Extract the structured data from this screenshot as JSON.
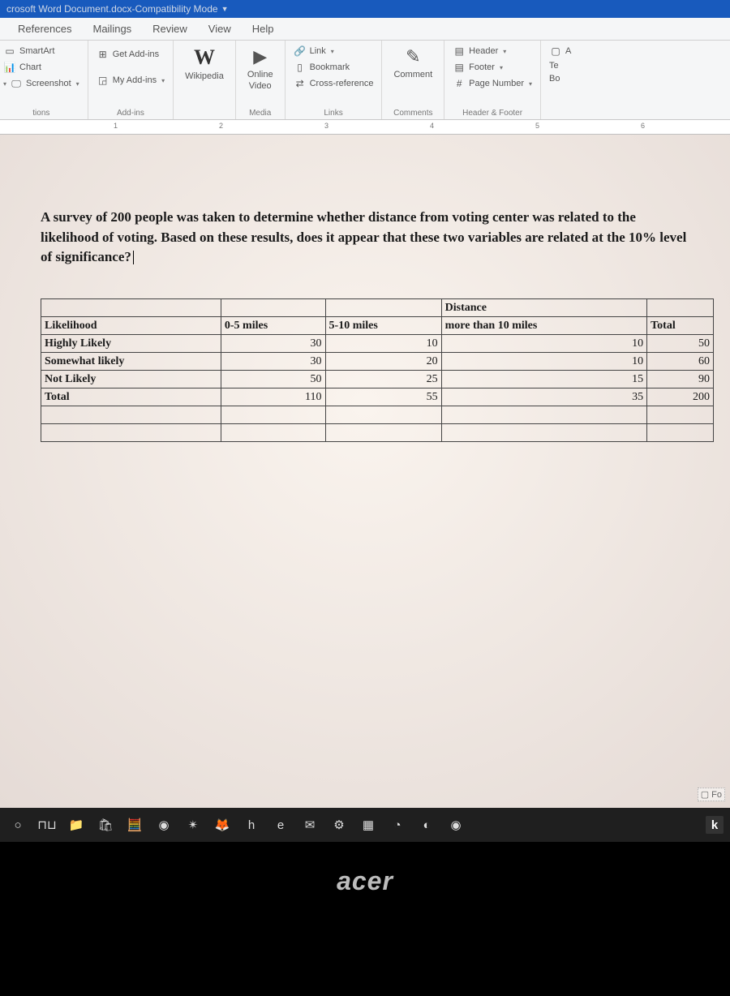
{
  "title": {
    "doc": "crosoft Word Document.docx",
    "sep": " - ",
    "mode": "Compatibility Mode"
  },
  "tabs": [
    "References",
    "Mailings",
    "Review",
    "View",
    "Help"
  ],
  "ribbon": {
    "illustrations": {
      "label": "tions",
      "smartart": "SmartArt",
      "chart": "Chart",
      "screenshot": "Screenshot"
    },
    "addins": {
      "label": "Add-ins",
      "get": "Get Add-ins",
      "my": "My Add-ins"
    },
    "wikipedia": {
      "label": "Wikipedia"
    },
    "media": {
      "label": "Media",
      "online": "Online",
      "video": "Video"
    },
    "links": {
      "label": "Links",
      "link": "Link",
      "bookmark": "Bookmark",
      "cross": "Cross-reference"
    },
    "comments": {
      "label": "Comments",
      "comment": "Comment"
    },
    "headerfooter": {
      "label": "Header & Footer",
      "header": "Header",
      "footer": "Footer",
      "pagenum": "Page Number"
    },
    "text": {
      "label_a": "A",
      "te": "Te",
      "bo": "Bo"
    }
  },
  "ruler_numbers": [
    "1",
    "2",
    "3",
    "4",
    "5",
    "6"
  ],
  "document": {
    "paragraph": "A survey of 200 people was taken to determine whether distance from voting center was related to the likelihood of voting. Based on these results, does it appear that these two variables are related at the 10% level of significance?",
    "table": {
      "distance_header": "Distance",
      "cols": [
        "Likelihood",
        "0-5 miles",
        "5-10 miles",
        "more than 10 miles",
        "Total"
      ],
      "rows": [
        {
          "label": "Highly Likely",
          "c1": "30",
          "c2": "10",
          "c3": "10",
          "total": "50"
        },
        {
          "label": "Somewhat likely",
          "c1": "30",
          "c2": "20",
          "c3": "10",
          "total": "60"
        },
        {
          "label": "Not Likely",
          "c1": "50",
          "c2": "25",
          "c3": "15",
          "total": "90"
        },
        {
          "label": "Total",
          "c1": "110",
          "c2": "55",
          "c3": "35",
          "total": "200"
        }
      ]
    },
    "focus_badge": "Fo"
  },
  "taskbar": {
    "items": [
      {
        "name": "search-circle-icon",
        "glyph": "○"
      },
      {
        "name": "task-view-icon",
        "glyph": "⊓⊔"
      },
      {
        "name": "file-explorer-icon",
        "glyph": "📁"
      },
      {
        "name": "store-icon",
        "glyph": "🛍"
      },
      {
        "name": "calculator-icon",
        "glyph": "🧮"
      },
      {
        "name": "steam-icon",
        "glyph": "◉"
      },
      {
        "name": "app-icon-1",
        "glyph": "✴"
      },
      {
        "name": "firefox-icon",
        "glyph": "🦊"
      },
      {
        "name": "h-icon",
        "glyph": "h"
      },
      {
        "name": "edge-icon",
        "glyph": "e"
      },
      {
        "name": "mail-icon",
        "glyph": "✉"
      },
      {
        "name": "settings-icon",
        "glyph": "⚙"
      },
      {
        "name": "minecraft-icon",
        "glyph": "▦"
      },
      {
        "name": "discord-icon",
        "glyph": "◔"
      },
      {
        "name": "app-icon-2",
        "glyph": "◐"
      },
      {
        "name": "chrome-icon",
        "glyph": "◉"
      }
    ],
    "k_badge": "k"
  },
  "brand": "acer",
  "chart_data": {
    "type": "table",
    "title": "Likelihood of voting by distance from voting center (survey of 200)",
    "columns": [
      "0-5 miles",
      "5-10 miles",
      "more than 10 miles",
      "Total"
    ],
    "rows": [
      "Highly Likely",
      "Somewhat likely",
      "Not Likely",
      "Total"
    ],
    "values": [
      [
        30,
        10,
        10,
        50
      ],
      [
        30,
        20,
        10,
        60
      ],
      [
        50,
        25,
        15,
        90
      ],
      [
        110,
        55,
        35,
        200
      ]
    ]
  }
}
